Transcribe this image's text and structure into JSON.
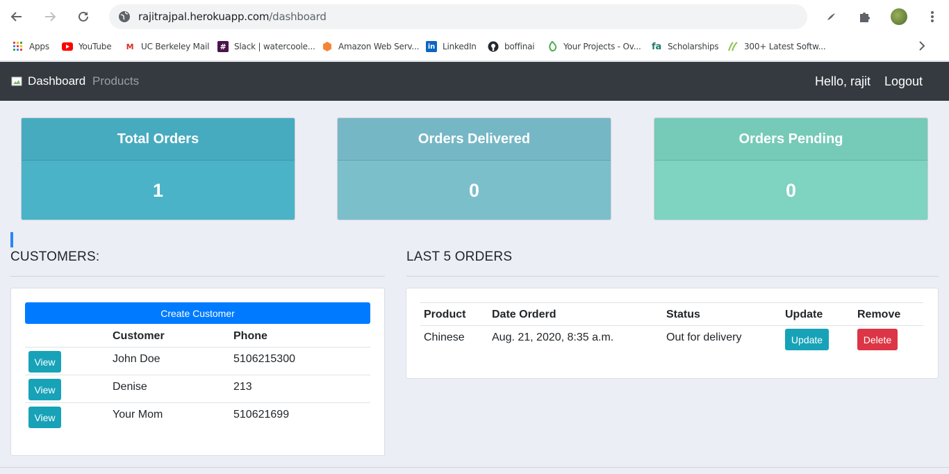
{
  "browser": {
    "url_host": "rajitrajpal.herokuapp.com",
    "url_path": "/dashboard",
    "bookmarks": [
      {
        "label": "Apps",
        "icon": "apps-grid-icon"
      },
      {
        "label": "YouTube",
        "icon": "youtube-icon"
      },
      {
        "label": "UC Berkeley Mail",
        "icon": "gmail-icon"
      },
      {
        "label": "Slack | watercoole...",
        "icon": "slack-icon"
      },
      {
        "label": "Amazon Web Serv...",
        "icon": "aws-icon"
      },
      {
        "label": "LinkedIn",
        "icon": "linkedin-icon"
      },
      {
        "label": "boffinai",
        "icon": "github-icon"
      },
      {
        "label": "Your Projects - Ov...",
        "icon": "leaf-icon"
      },
      {
        "label": "Scholarships",
        "icon": "fa-icon"
      },
      {
        "label": "300+ Latest Softw...",
        "icon": "script-icon"
      }
    ]
  },
  "navbar": {
    "brand": "Dashboard",
    "products": "Products",
    "greeting": "Hello, rajit",
    "logout": "Logout"
  },
  "stats": [
    {
      "label": "Total Orders",
      "value": "1",
      "head_color": "#47abc0",
      "body_color": "#4ab3c7"
    },
    {
      "label": "Orders Delivered",
      "value": "0",
      "head_color": "#76b7c6",
      "body_color": "#7bbfcb"
    },
    {
      "label": "Orders Pending",
      "value": "0",
      "head_color": "#76cab8",
      "body_color": "#7ed3c1"
    }
  ],
  "customers": {
    "title": "CUSTOMERS:",
    "create_button": "Create Customer",
    "columns": [
      "Customer",
      "Phone"
    ],
    "view_label": "View",
    "rows": [
      {
        "name": "John Doe",
        "phone": "5106215300"
      },
      {
        "name": "Denise",
        "phone": "213"
      },
      {
        "name": "Your Mom",
        "phone": "510621699"
      }
    ]
  },
  "orders": {
    "title": "LAST 5 ORDERS",
    "columns": [
      "Product",
      "Date Orderd",
      "Status",
      "Update",
      "Remove"
    ],
    "rows": [
      {
        "product": "Chinese",
        "date": "Aug. 21, 2020, 8:35 a.m.",
        "status": "Out for delivery",
        "update_label": "Update",
        "delete_label": "Delete"
      }
    ]
  }
}
